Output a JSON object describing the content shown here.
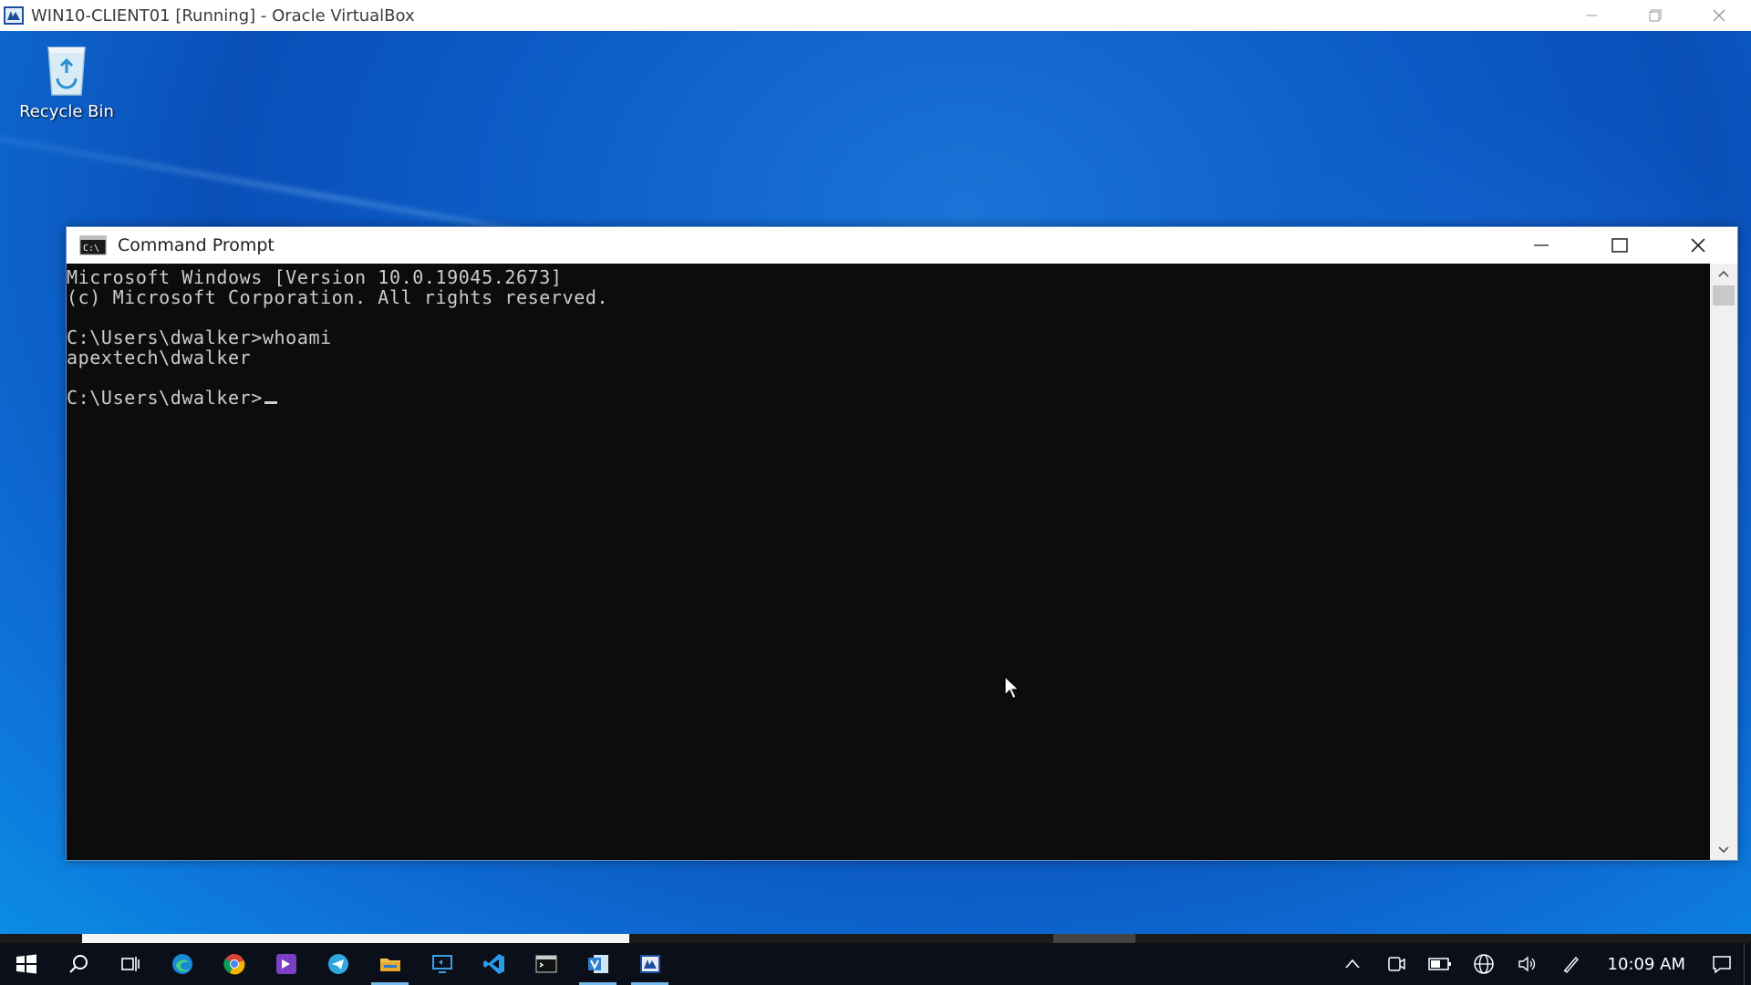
{
  "host": {
    "title": "WIN10-CLIENT01 [Running] - Oracle VirtualBox",
    "icon": "virtualbox-icon"
  },
  "desktop": {
    "icons": [
      {
        "label": "Recycle Bin",
        "icon": "recycle-bin-icon"
      }
    ]
  },
  "cmd": {
    "title": "Command Prompt",
    "lines": [
      "Microsoft Windows [Version 10.0.19045.2673]",
      "(c) Microsoft Corporation. All rights reserved.",
      "",
      "C:\\Users\\dwalker>whoami",
      "apextech\\dwalker",
      "",
      "C:\\Users\\dwalker>"
    ]
  },
  "taskbar": {
    "apps": [
      "start-icon",
      "search-icon",
      "task-view-icon",
      "edge-icon",
      "chrome-icon",
      "visual-studio-icon",
      "telegram-icon",
      "file-explorer-icon",
      "remote-desktop-icon",
      "vscode-icon",
      "terminal-icon",
      "visio-icon",
      "virtualbox-icon"
    ],
    "tray": [
      "chevron-up-icon",
      "meet-now-icon",
      "battery-icon",
      "network-icon",
      "volume-icon",
      "pen-icon"
    ],
    "clock": "10:09 AM"
  },
  "colors": {
    "console_bg": "#0c0c0c",
    "console_text": "#cccccc",
    "taskbar_bg": "#0a0f1a",
    "active_indicator": "#76b9ed"
  }
}
